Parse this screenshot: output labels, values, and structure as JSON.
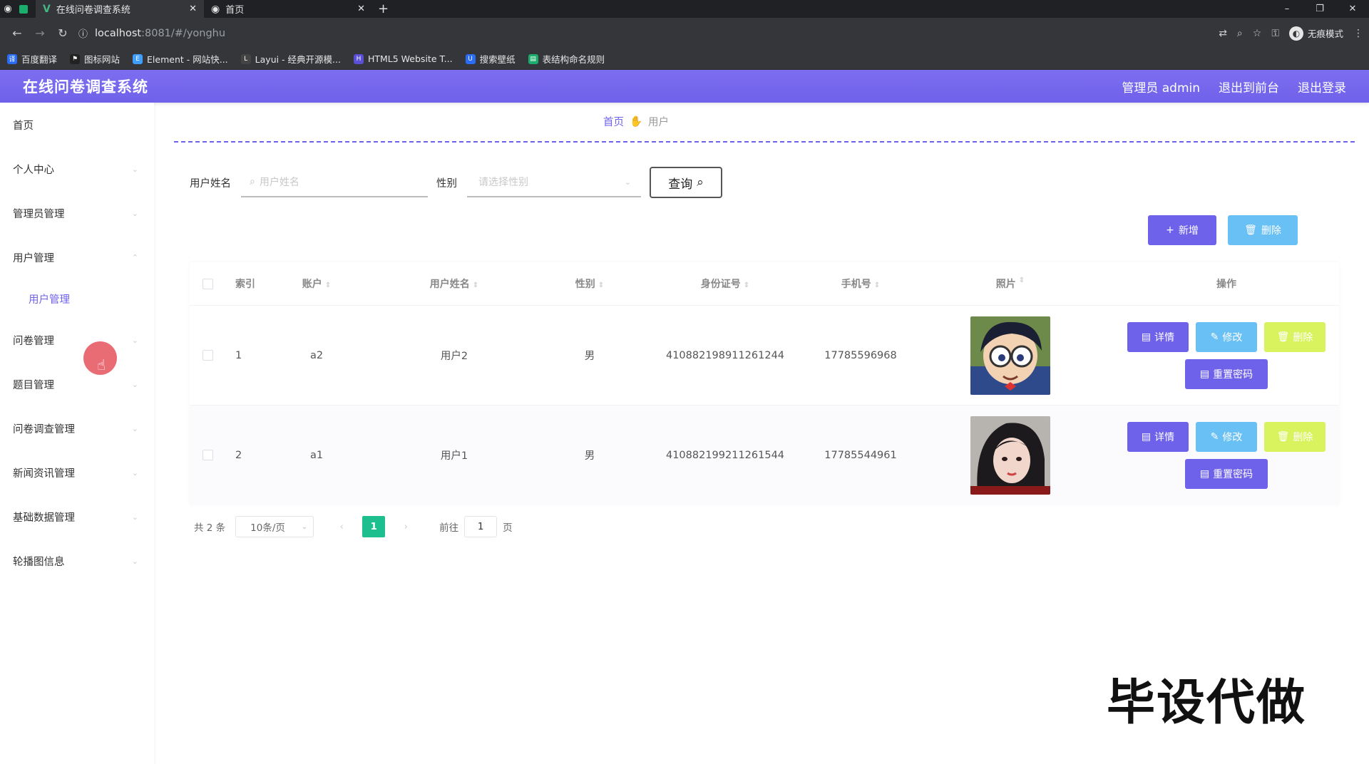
{
  "browser": {
    "tabs": [
      {
        "label": "在线问卷调查系统",
        "active": true
      },
      {
        "label": "首页",
        "active": false
      }
    ],
    "url_host": "localhost",
    "url_rest": ":8081/#/yonghu",
    "profile_label": "无痕模式",
    "bookmarks": [
      "百度翻译",
      "图标网站",
      "Element - 网站快...",
      "Layui - 经典开源模...",
      "HTML5 Website T...",
      "搜索壁纸",
      "表结构命名规则"
    ]
  },
  "header": {
    "title": "在线问卷调查系统",
    "admin": "管理员 admin",
    "back_front": "退出到前台",
    "logout": "退出登录",
    "color": "#7367ee"
  },
  "sidebar": {
    "items": [
      {
        "label": "首页"
      },
      {
        "label": "个人中心"
      },
      {
        "label": "管理员管理"
      },
      {
        "label": "用户管理"
      },
      {
        "label": "用户管理",
        "sub": true
      },
      {
        "label": "问卷管理"
      },
      {
        "label": "题目管理"
      },
      {
        "label": "问卷调查管理"
      },
      {
        "label": "新闻资讯管理"
      },
      {
        "label": "基础数据管理"
      },
      {
        "label": "轮播图信息"
      }
    ]
  },
  "breadcrumb": {
    "home": "首页",
    "current": "用户"
  },
  "search": {
    "name_label": "用户姓名",
    "name_placeholder": "用户姓名",
    "sex_label": "性别",
    "sex_placeholder": "请选择性别",
    "query_label": "查询"
  },
  "toolbar": {
    "add_label": "新增",
    "delete_label": "删除"
  },
  "table": {
    "headers": [
      "索引",
      "账户",
      "用户姓名",
      "性别",
      "身份证号",
      "手机号",
      "照片",
      "操作"
    ],
    "rows": [
      {
        "index": "1",
        "account": "a2",
        "name": "用户2",
        "sex": "男",
        "id_card": "410882198911261244",
        "phone": "17785596968",
        "photo": "cartoon-boy-glasses"
      },
      {
        "index": "2",
        "account": "a1",
        "name": "用户1",
        "sex": "男",
        "id_card": "410882199211261544",
        "phone": "17785544961",
        "photo": "girl-portrait"
      }
    ],
    "ops": {
      "detail": "详情",
      "edit": "修改",
      "delete": "删除",
      "reset": "重置密码"
    }
  },
  "pager": {
    "total": "共 2 条",
    "size": "10条/页",
    "current": "1",
    "goto_prefix": "前往",
    "goto_value": "1",
    "goto_suffix": "页"
  },
  "watermark": "毕设代做"
}
